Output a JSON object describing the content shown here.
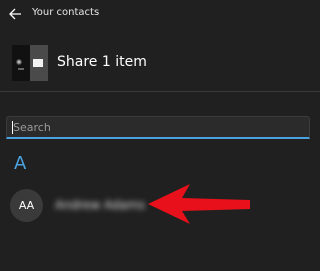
{
  "header": {
    "title": "Your contacts",
    "back_icon": "back-arrow-icon"
  },
  "share": {
    "title": "Share 1 item"
  },
  "search": {
    "placeholder": "Search",
    "value": ""
  },
  "contacts": {
    "group_letter": "A",
    "items": [
      {
        "initials": "AA",
        "name": "Andrew Adams"
      }
    ]
  },
  "colors": {
    "background": "#202020",
    "accent": "#4aa3df",
    "annotation_arrow": "#e8101a"
  }
}
